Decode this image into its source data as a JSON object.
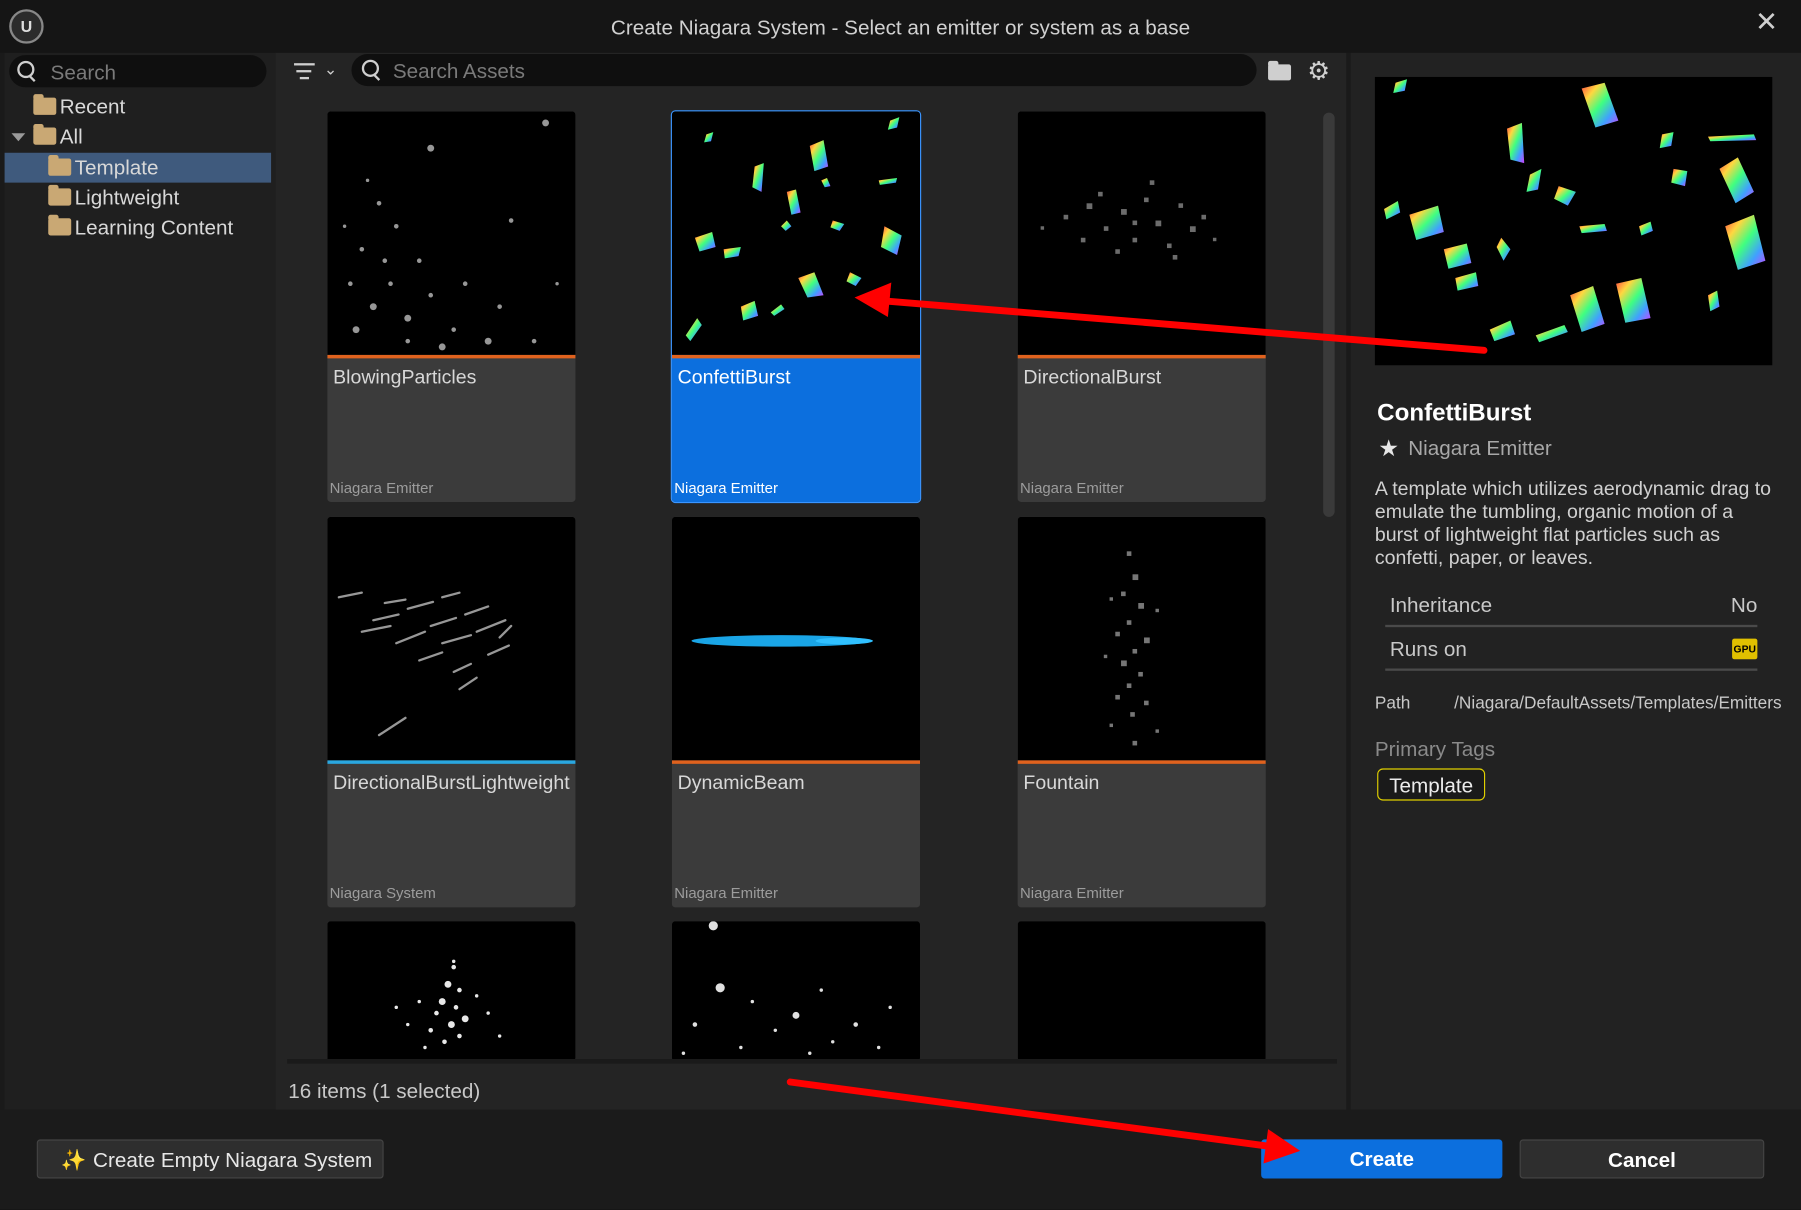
{
  "window": {
    "title": "Create Niagara System - Select an emitter or system as a base",
    "close_glyph": "✕",
    "logo_text": "U"
  },
  "tree": {
    "search_placeholder": "Search",
    "items": [
      {
        "label": "Recent"
      },
      {
        "label": "All"
      },
      {
        "label": "Template"
      },
      {
        "label": "Lightweight"
      },
      {
        "label": "Learning Content"
      }
    ]
  },
  "asset_search": {
    "placeholder": "Search Assets"
  },
  "assets": [
    {
      "name": "BlowingParticles",
      "type": "Niagara Emitter",
      "bar_color": "#e0621e"
    },
    {
      "name": "ConfettiBurst",
      "type": "Niagara Emitter",
      "bar_color": "#e0621e",
      "selected": true
    },
    {
      "name": "DirectionalBurst",
      "type": "Niagara Emitter",
      "bar_color": "#e0621e"
    },
    {
      "name": "DirectionalBurstLightweight",
      "type": "Niagara System",
      "bar_color": "#2aa7e0"
    },
    {
      "name": "DynamicBeam",
      "type": "Niagara Emitter",
      "bar_color": "#e0621e"
    },
    {
      "name": "Fountain",
      "type": "Niagara Emitter",
      "bar_color": "#e0621e"
    }
  ],
  "status": {
    "text": "16 items (1 selected)"
  },
  "details": {
    "title": "ConfettiBurst",
    "type": "Niagara Emitter",
    "description": "A template which utilizes aerodynamic drag to emulate the tumbling, organic motion of a burst of lightweight flat particles such as confetti, paper, or leaves.",
    "inheritance_label": "Inheritance",
    "inheritance_value": "No",
    "runs_on_label": "Runs on",
    "runs_on_value": "GPU",
    "path_label": "Path",
    "path_value": "/Niagara/DefaultAssets/Templates/Emitters",
    "tags_label": "Primary Tags",
    "tags": [
      "Template"
    ]
  },
  "buttons": {
    "create_empty": "Create Empty Niagara System",
    "create": "Create",
    "cancel": "Cancel"
  },
  "colors": {
    "accent": "#0c6fde",
    "annotation_arrow": "#ff0000",
    "emitter_bar": "#e0621e",
    "system_bar": "#2aa7e0",
    "tag_border": "#e0d000"
  }
}
